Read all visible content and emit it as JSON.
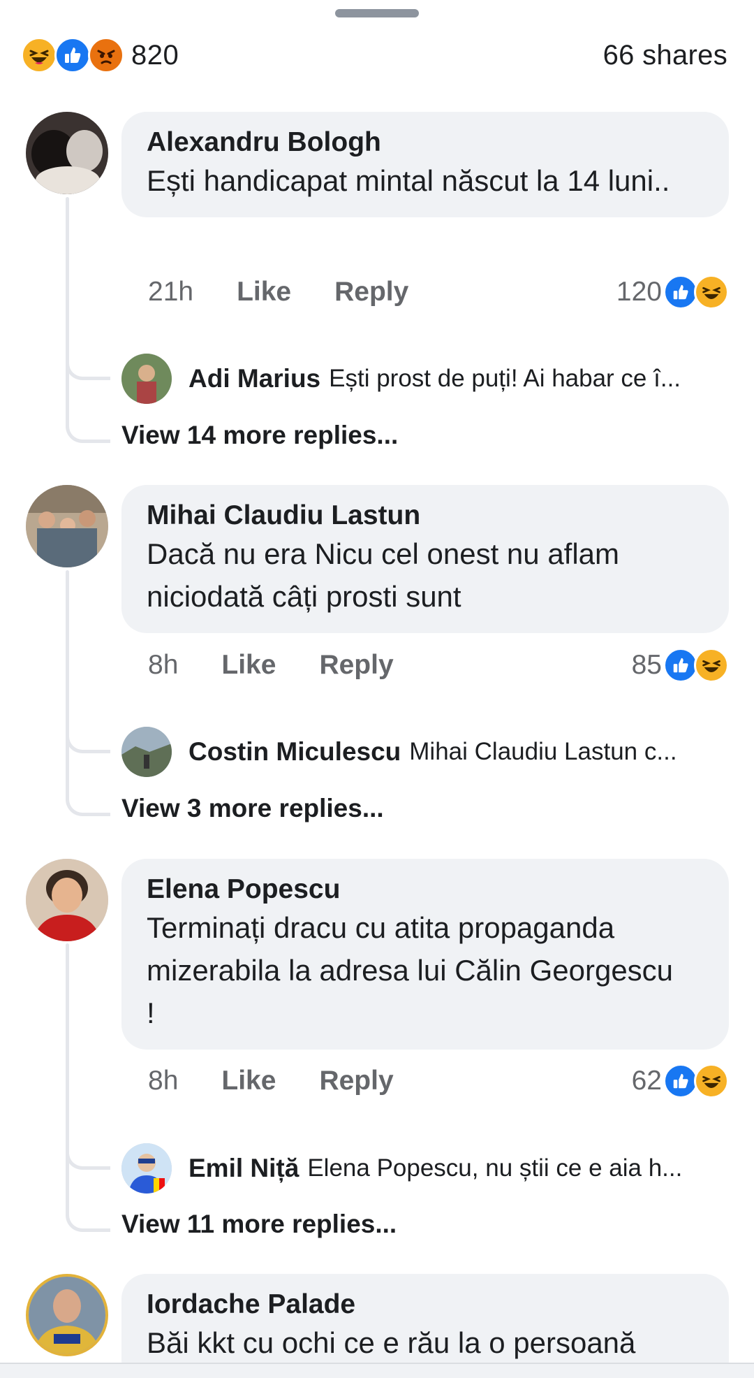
{
  "post": {
    "reaction_count": "820",
    "shares": "66 shares",
    "reactions": [
      "haha-icon",
      "like-icon",
      "angry-icon"
    ]
  },
  "actions": {
    "like": "Like",
    "reply": "Reply"
  },
  "comments": [
    {
      "author": "Alexandru Bologh",
      "text": "Ești handicapat mintal născut la 14 luni..",
      "time": "21h",
      "reaction_count": "120",
      "reply_preview": {
        "author": "Adi Marius",
        "text": "Ești prost de puți! Ai habar ce î..."
      },
      "more_replies": "View 14 more replies..."
    },
    {
      "author": "Mihai Claudiu Lastun",
      "text": "Dacă nu era Nicu cel onest nu aflam niciodată câți prosti sunt",
      "time": "8h",
      "reaction_count": "85",
      "reply_preview": {
        "author": "Costin Miculescu",
        "text": "Mihai Claudiu Lastun c..."
      },
      "more_replies": "View 3 more replies..."
    },
    {
      "author": "Elena Popescu",
      "text": "Terminați dracu cu atita propaganda mizerabila la adresa lui Călin Georgescu    !",
      "time": "8h",
      "reaction_count": "62",
      "reply_preview": {
        "author": "Emil Niță",
        "text": "Elena Popescu, nu știi ce e aia h..."
      },
      "more_replies": "View 11 more replies..."
    },
    {
      "author": "Iordache Palade",
      "text": "Băi kkt cu ochi ce e rău la o persoană"
    }
  ],
  "colors": {
    "bubble": "#f0f2f5",
    "like_blue": "#1877f2",
    "haha_yellow": "#f7b125",
    "angry_orange": "#e9710f",
    "secondary_text": "#65676b"
  }
}
